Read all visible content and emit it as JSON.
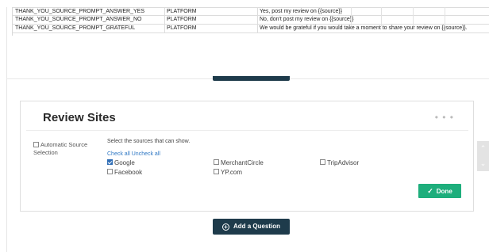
{
  "sheet": {
    "rows": [
      {
        "key": "THANK_YOU_SOURCE_PROMPT_ANSWER_YES",
        "type": "PLATFORM",
        "value": "Yes, post my review on {{source}}"
      },
      {
        "key": "THANK_YOU_SOURCE_PROMPT_ANSWER_NO",
        "type": "PLATFORM",
        "value": "No, don't post my review on {{source}}"
      },
      {
        "key": "THANK_YOU_SOURCE_PROMPT_GRATEFUL",
        "type": "PLATFORM",
        "value": "We would be grateful if you would take a moment to share your review on {{source}}."
      }
    ]
  },
  "card": {
    "title": "Review Sites",
    "more_icon": "ellipsis-icon",
    "auto_source_label": "Automatic Source Selection",
    "auto_source_checked": false,
    "select_label": "Select the sources that can show.",
    "check_all": "Check all",
    "uncheck_all": "Uncheck all",
    "sources": [
      {
        "label": "Google",
        "checked": true
      },
      {
        "label": "MerchantCircle",
        "checked": false
      },
      {
        "label": "TripAdvisor",
        "checked": false
      },
      {
        "label": "Facebook",
        "checked": false
      },
      {
        "label": "YP.com",
        "checked": false
      }
    ],
    "done_label": "Done"
  },
  "add_question_label": "Add a Question",
  "colors": {
    "dark_button": "#1e3b4b",
    "done_button": "#1eae7c",
    "checkbox_on": "#2f6db5",
    "link": "#2f78c4"
  }
}
